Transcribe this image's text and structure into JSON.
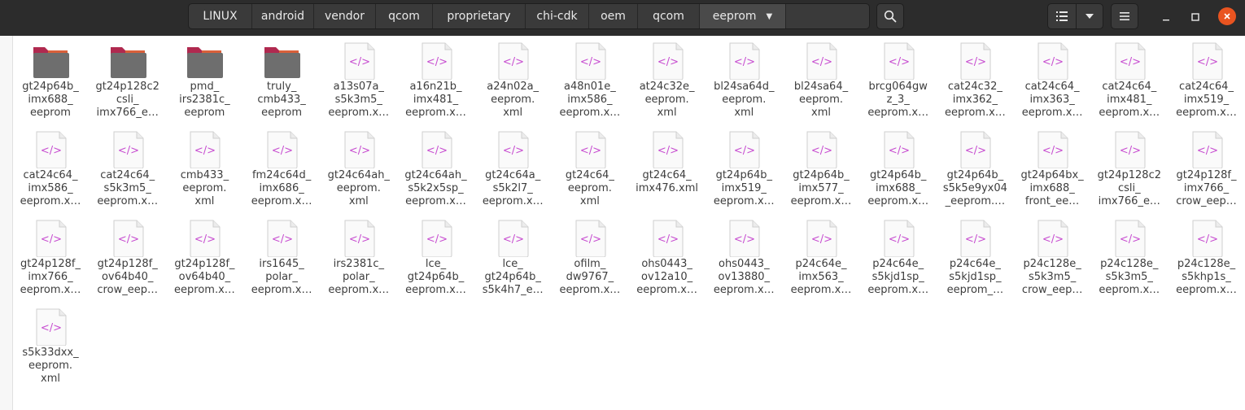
{
  "window": {
    "path": [
      "LINUX",
      "android",
      "vendor",
      "qcom",
      "proprietary",
      "chi-cdk",
      "oem",
      "qcom",
      "eeprom"
    ],
    "accent_color": "#e95420",
    "icons": {
      "search": "search-icon",
      "list_view": "list-view-icon",
      "view_options": "chevron-down-icon",
      "menu": "hamburger-menu-icon",
      "minimize": "minimize-icon",
      "maximize": "maximize-icon",
      "close": "close-icon"
    }
  },
  "files": [
    {
      "type": "folder",
      "lines": [
        "gt24p64b_",
        "imx688_",
        "eeprom"
      ]
    },
    {
      "type": "folder",
      "lines": [
        "gt24p128c2",
        "csli_",
        "imx766_e…"
      ]
    },
    {
      "type": "folder",
      "lines": [
        "pmd_",
        "irs2381c_",
        "eeprom"
      ]
    },
    {
      "type": "folder",
      "lines": [
        "truly_",
        "cmb433_",
        "eeprom"
      ]
    },
    {
      "type": "xml",
      "lines": [
        "a13s07a_",
        "s5k3m5_",
        "eeprom.x…"
      ]
    },
    {
      "type": "xml",
      "lines": [
        "a16n21b_",
        "imx481_",
        "eeprom.x…"
      ]
    },
    {
      "type": "xml",
      "lines": [
        "a24n02a_",
        "eeprom.",
        "xml"
      ]
    },
    {
      "type": "xml",
      "lines": [
        "a48n01e_",
        "imx586_",
        "eeprom.x…"
      ]
    },
    {
      "type": "xml",
      "lines": [
        "at24c32e_",
        "eeprom.",
        "xml"
      ]
    },
    {
      "type": "xml",
      "lines": [
        "bl24sa64d_",
        "eeprom.",
        "xml"
      ]
    },
    {
      "type": "xml",
      "lines": [
        "bl24sa64_",
        "eeprom.",
        "xml"
      ]
    },
    {
      "type": "xml",
      "lines": [
        "brcg064gw",
        "z_3_",
        "eeprom.x…"
      ]
    },
    {
      "type": "xml",
      "lines": [
        "cat24c32_",
        "imx362_",
        "eeprom.x…"
      ]
    },
    {
      "type": "xml",
      "lines": [
        "cat24c64_",
        "imx363_",
        "eeprom.x…"
      ]
    },
    {
      "type": "xml",
      "lines": [
        "cat24c64_",
        "imx481_",
        "eeprom.x…"
      ]
    },
    {
      "type": "xml",
      "lines": [
        "cat24c64_",
        "imx519_",
        "eeprom.x…"
      ]
    },
    {
      "type": "xml",
      "lines": [
        "cat24c64_",
        "imx586_",
        "eeprom.x…"
      ]
    },
    {
      "type": "xml",
      "lines": [
        "cat24c64_",
        "s5k3m5_",
        "eeprom.x…"
      ]
    },
    {
      "type": "xml",
      "lines": [
        "cmb433_",
        "eeprom.",
        "xml"
      ]
    },
    {
      "type": "xml",
      "lines": [
        "fm24c64d_",
        "imx686_",
        "eeprom.x…"
      ]
    },
    {
      "type": "xml",
      "lines": [
        "gt24c64ah_",
        "eeprom.",
        "xml"
      ]
    },
    {
      "type": "xml",
      "lines": [
        "gt24c64ah_",
        "s5k2x5sp_",
        "eeprom.x…"
      ]
    },
    {
      "type": "xml",
      "lines": [
        "gt24c64a_",
        "s5k2l7_",
        "eeprom.x…"
      ]
    },
    {
      "type": "xml",
      "lines": [
        "gt24c64_",
        "eeprom.",
        "xml"
      ]
    },
    {
      "type": "xml",
      "lines": [
        "gt24c64_",
        "imx476.xml"
      ]
    },
    {
      "type": "xml",
      "lines": [
        "gt24p64b_",
        "imx519_",
        "eeprom.x…"
      ]
    },
    {
      "type": "xml",
      "lines": [
        "gt24p64b_",
        "imx577_",
        "eeprom.x…"
      ]
    },
    {
      "type": "xml",
      "lines": [
        "gt24p64b_",
        "imx688_",
        "eeprom.x…"
      ]
    },
    {
      "type": "xml",
      "lines": [
        "gt24p64b_",
        "s5k5e9yx04",
        "_eeprom.…"
      ]
    },
    {
      "type": "xml",
      "lines": [
        "gt24p64bx_",
        "imx688_",
        "front_ee…"
      ]
    },
    {
      "type": "xml",
      "lines": [
        "gt24p128c2",
        "csli_",
        "imx766_e…"
      ]
    },
    {
      "type": "xml",
      "lines": [
        "gt24p128f_",
        "imx766_",
        "crow_eep…"
      ]
    },
    {
      "type": "xml",
      "lines": [
        "gt24p128f_",
        "imx766_",
        "eeprom.x…"
      ]
    },
    {
      "type": "xml",
      "lines": [
        "gt24p128f_",
        "ov64b40_",
        "crow_eep…"
      ]
    },
    {
      "type": "xml",
      "lines": [
        "gt24p128f_",
        "ov64b40_",
        "eeprom.x…"
      ]
    },
    {
      "type": "xml",
      "lines": [
        "irs1645_",
        "polar_",
        "eeprom.x…"
      ]
    },
    {
      "type": "xml",
      "lines": [
        "irs2381c_",
        "polar_",
        "eeprom.x…"
      ]
    },
    {
      "type": "xml",
      "lines": [
        "lce_",
        "gt24p64b_",
        "eeprom.x…"
      ]
    },
    {
      "type": "xml",
      "lines": [
        "lce_",
        "gt24p64b_",
        "s5k4h7_e…"
      ]
    },
    {
      "type": "xml",
      "lines": [
        "ofilm_",
        "dw9767_",
        "eeprom.x…"
      ]
    },
    {
      "type": "xml",
      "lines": [
        "ohs0443_",
        "ov12a10_",
        "eeprom.x…"
      ]
    },
    {
      "type": "xml",
      "lines": [
        "ohs0443_",
        "ov13880_",
        "eeprom.x…"
      ]
    },
    {
      "type": "xml",
      "lines": [
        "p24c64e_",
        "imx563_",
        "eeprom.x…"
      ]
    },
    {
      "type": "xml",
      "lines": [
        "p24c64e_",
        "s5kjd1sp_",
        "eeprom.x…"
      ]
    },
    {
      "type": "xml",
      "lines": [
        "p24c64e_",
        "s5kjd1sp_",
        "eeprom_…"
      ]
    },
    {
      "type": "xml",
      "lines": [
        "p24c128e_",
        "s5k3m5_",
        "crow_eep…"
      ]
    },
    {
      "type": "xml",
      "lines": [
        "p24c128e_",
        "s5k3m5_",
        "eeprom.x…"
      ]
    },
    {
      "type": "xml",
      "lines": [
        "p24c128e_",
        "s5khp1s_",
        "eeprom.x…"
      ]
    },
    {
      "type": "xml",
      "lines": [
        "s5k33dxx_",
        "eeprom.",
        "xml"
      ]
    }
  ]
}
